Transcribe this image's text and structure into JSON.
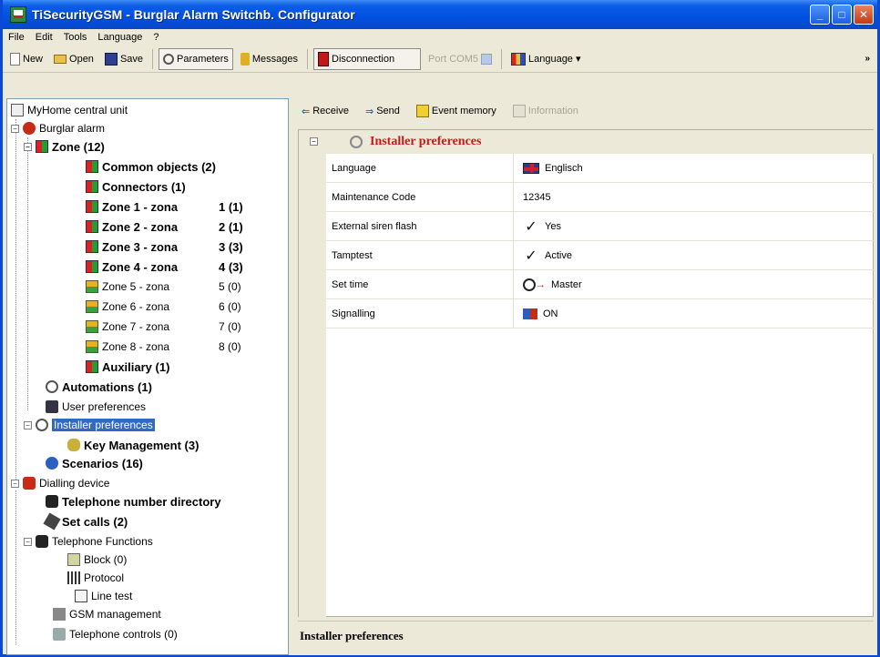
{
  "window": {
    "title": "TiSecurityGSM - Burglar Alarm Switchb. Configurator"
  },
  "menu": [
    "File",
    "Edit",
    "Tools",
    "Language",
    "?"
  ],
  "toolbar": {
    "new": "New",
    "open": "Open",
    "save": "Save",
    "parameters": "Parameters",
    "messages": "Messages",
    "disconnection": "Disconnection",
    "port": "Port",
    "com": "COM5",
    "language": "Language"
  },
  "tree": {
    "root": "MyHome central unit",
    "burglar_alarm": "Burglar alarm",
    "zone": "Zone (12)",
    "common_objects": "Common objects (2)",
    "connectors": "Connectors (1)",
    "zones": [
      {
        "label": "Zone 1 - zona",
        "count": "1 (1)"
      },
      {
        "label": "Zone 2 - zona",
        "count": "2 (1)"
      },
      {
        "label": "Zone 3 - zona",
        "count": "3 (3)"
      },
      {
        "label": "Zone 4 - zona",
        "count": "4 (3)"
      },
      {
        "label": "Zone 5 - zona",
        "count": "5 (0)"
      },
      {
        "label": "Zone 6 - zona",
        "count": "6 (0)"
      },
      {
        "label": "Zone 7 - zona",
        "count": "7 (0)"
      },
      {
        "label": "Zone 8 - zona",
        "count": "8 (0)"
      }
    ],
    "auxiliary": "Auxiliary (1)",
    "automations": "Automations (1)",
    "user_preferences": "User preferences",
    "installer_preferences": "Installer preferences",
    "key_management": "Key Management (3)",
    "scenarios": "Scenarios (16)",
    "dialling_device": "Dialling device",
    "telephone_directory": "Telephone number directory",
    "set_calls": "Set calls (2)",
    "telephone_functions": "Telephone Functions",
    "block": "Block (0)",
    "protocol": "Protocol",
    "line_test": "Line test",
    "gsm_management": "GSM management",
    "telephone_controls": "Telephone controls (0)"
  },
  "subtoolbar": {
    "receive": "Receive",
    "send": "Send",
    "event_memory": "Event memory",
    "information": "Information"
  },
  "grid": {
    "section_title": "Installer preferences",
    "rows": [
      {
        "name": "Language",
        "value": "Englisch",
        "icon": "flag-uk-icon"
      },
      {
        "name": "Maintenance Code",
        "value": "12345",
        "icon": ""
      },
      {
        "name": "External siren flash",
        "value": "Yes",
        "icon": "check-icon"
      },
      {
        "name": "Tamptest",
        "value": "Active",
        "icon": "check-icon"
      },
      {
        "name": "Set time",
        "value": "Master",
        "icon": "clock-icon"
      },
      {
        "name": "Signalling",
        "value": "ON",
        "icon": "signal-icon"
      }
    ]
  },
  "status": {
    "description": "Installer preferences"
  }
}
